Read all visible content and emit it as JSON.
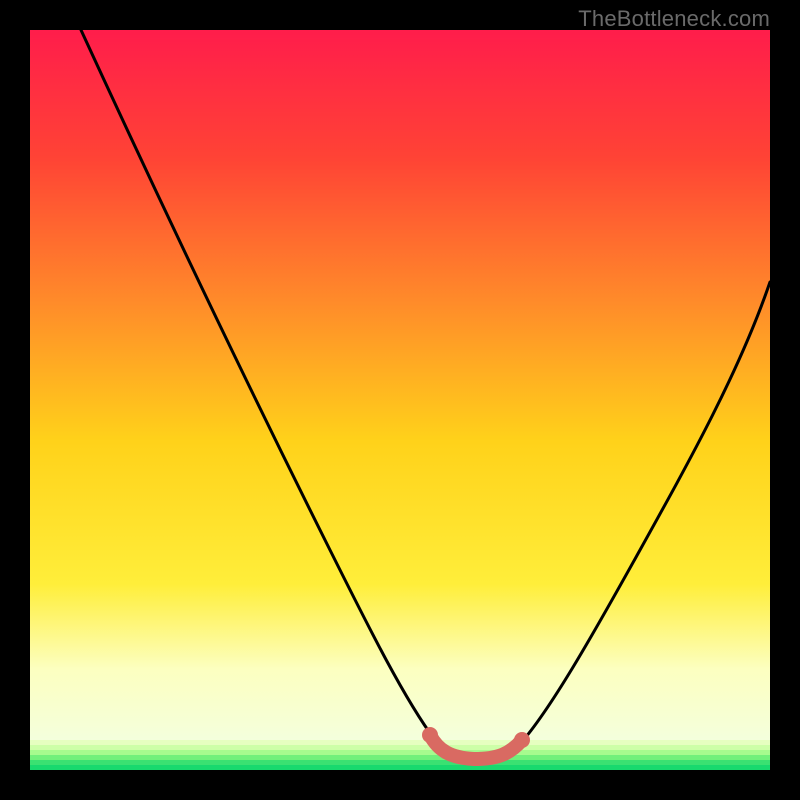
{
  "watermark": "TheBottleneck.com",
  "chart_data": {
    "type": "line",
    "title": "",
    "xlabel": "",
    "ylabel": "",
    "xlim": [
      0,
      100
    ],
    "ylim": [
      0,
      100
    ],
    "series": [
      {
        "name": "curve",
        "x": [
          7,
          12,
          18,
          24,
          30,
          36,
          42,
          48,
          52,
          55,
          57,
          60,
          64,
          66,
          70,
          76,
          82,
          88,
          94,
          100
        ],
        "y": [
          100,
          92,
          82,
          72,
          62,
          51,
          40,
          27,
          16,
          8,
          3,
          1.5,
          1.5,
          3,
          9,
          21,
          33,
          45,
          56,
          66
        ]
      }
    ],
    "highlight_segment": {
      "name": "bottleneck-range",
      "x": [
        55,
        57,
        60,
        64,
        66
      ],
      "y": [
        8,
        3,
        1.5,
        1.5,
        3
      ]
    },
    "background_gradient": {
      "top": "#ff1d4b",
      "mid1": "#ff7a2a",
      "mid2": "#ffe500",
      "low": "#f6ffd9",
      "bottom_stripes": [
        "#e5ffc3",
        "#d2ffb0",
        "#b8ff9e",
        "#8dfa86",
        "#4de879",
        "#18d96e"
      ]
    }
  }
}
